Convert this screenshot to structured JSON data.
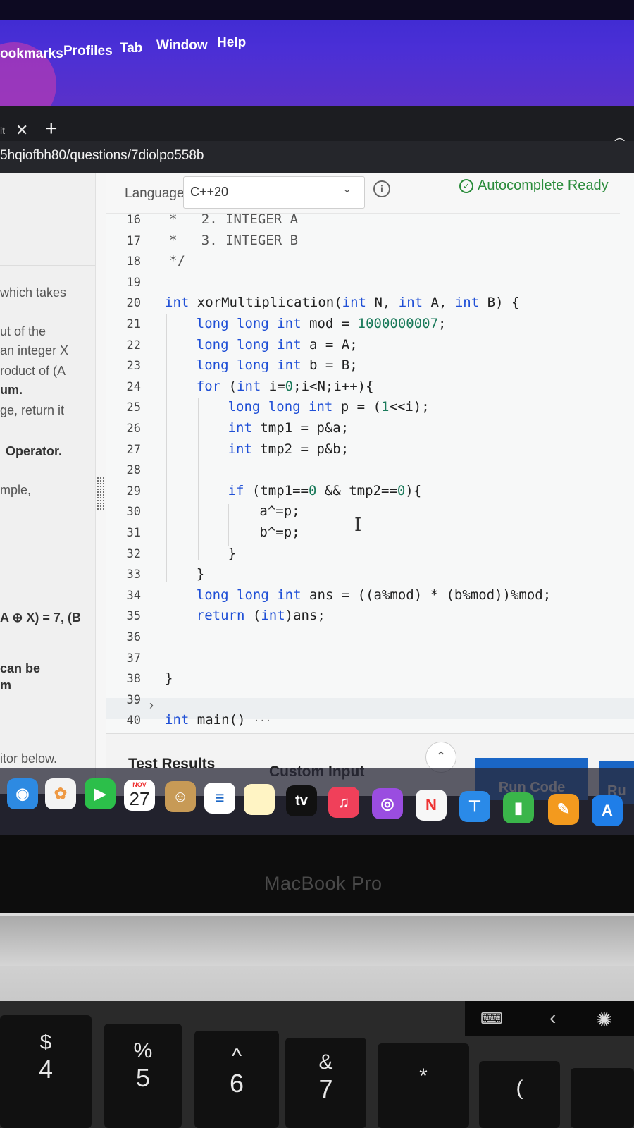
{
  "menubar": {
    "items": [
      "ookmarks",
      "Profiles",
      "Tab",
      "Window",
      "Help"
    ]
  },
  "browser": {
    "tab_label": "it",
    "url": "5hqiofbh80/questions/7diolpo558b"
  },
  "left_panel": {
    "lines": [
      "which takes",
      "ut of the",
      "an integer X",
      "roduct of (A",
      "um.",
      "ge, return it",
      "Operator.",
      "mple,",
      "A ⊕ X) = 7, (B",
      "can be",
      "m",
      "itor below."
    ]
  },
  "editor": {
    "language_label": "Language",
    "language_value": "C++20",
    "autocomplete_status": "Autocomplete Ready",
    "line_numbers": [
      "16",
      "17",
      "18",
      "19",
      "20",
      "21",
      "22",
      "23",
      "24",
      "25",
      "26",
      "27",
      "28",
      "29",
      "30",
      "31",
      "32",
      "33",
      "34",
      "35",
      "36",
      "37",
      "38",
      "39",
      "40"
    ],
    "code_lines": [
      "*   2. INTEGER A",
      "*   3. INTEGER B",
      "*/",
      "",
      "int xorMultiplication(int N, int A, int B) {",
      "    long long int mod = 1000000007;",
      "    long long int a = A;",
      "    long long int b = B;",
      "    for (int i=0;i<N;i++){",
      "        long long int p = (1<<i);",
      "        int tmp1 = p&a;",
      "        int tmp2 = p&b;",
      "",
      "        if (tmp1==0 && tmp2==0){",
      "            a^=p;",
      "            b^=p;",
      "        }",
      "    }",
      "    long long int ans = ((a%mod) * (b%mod))%mod;",
      "    return (int)ans;",
      "",
      "",
      "}",
      "",
      "int main()"
    ],
    "folded_ellipsis": "···"
  },
  "results": {
    "tab_test_results": "Test Results",
    "tab_custom_input": "Custom Input",
    "run_code": "Run Code",
    "run_partial": "Ru"
  },
  "dock": {
    "calendar_month": "NOV",
    "calendar_day": "27",
    "tv_label": "tv"
  },
  "laptop": {
    "brand": "MacBook Pro"
  },
  "keyboard": {
    "keys": [
      {
        "top": "$",
        "bottom": "4"
      },
      {
        "top": "%",
        "bottom": "5"
      },
      {
        "top": "^",
        "bottom": "6"
      },
      {
        "top": "&",
        "bottom": "7"
      },
      {
        "top": "*",
        "bottom": ""
      },
      {
        "top": "(",
        "bottom": ""
      }
    ]
  },
  "colors": {
    "menubar": "#4a2fd6",
    "accent_blue": "#1a66c6",
    "autocomplete_green": "#2a8c3b",
    "keyword_blue": "#1f4fd6"
  }
}
